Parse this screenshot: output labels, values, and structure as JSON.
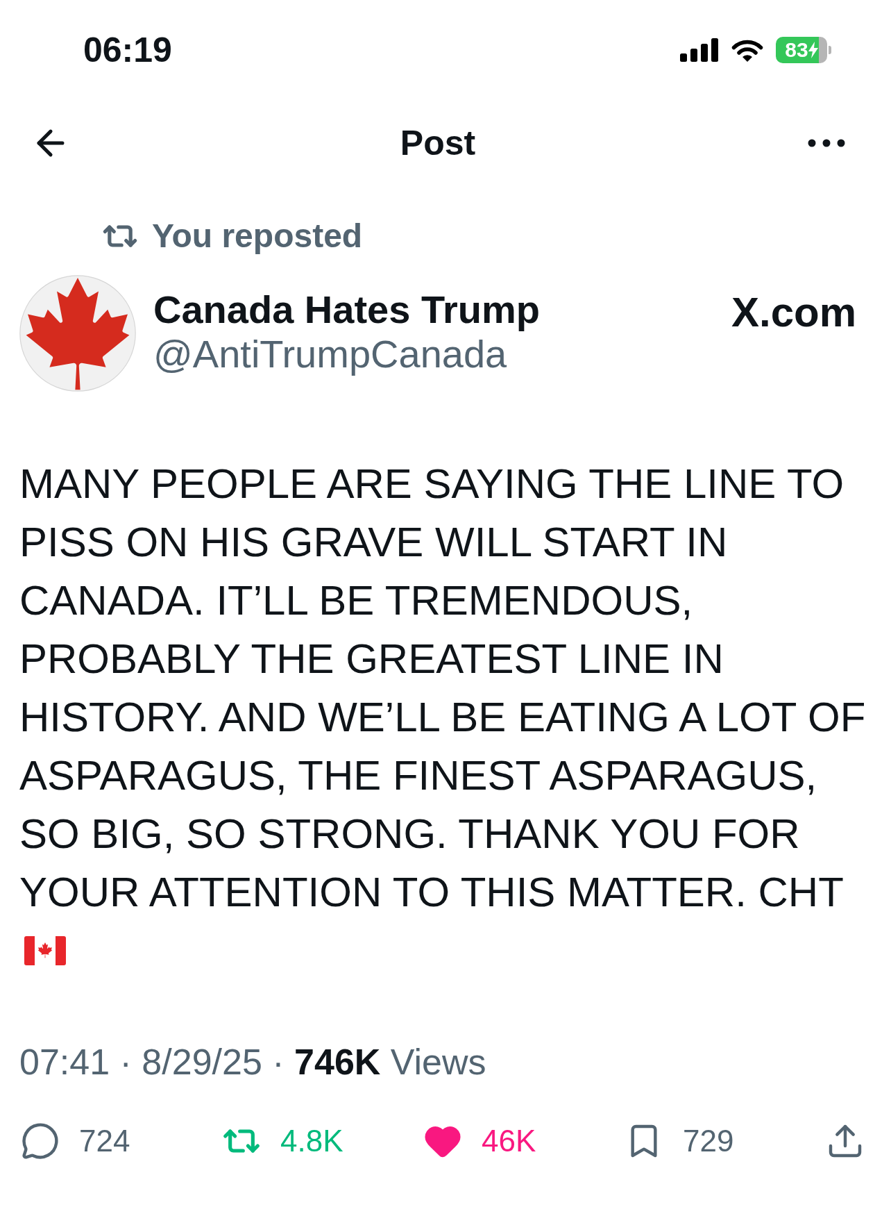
{
  "status_bar": {
    "time": "06:19",
    "battery": "83"
  },
  "header": {
    "title": "Post"
  },
  "repost_label": "You reposted",
  "author": {
    "name": "Canada Hates Trump",
    "handle": "@AntiTrumpCanada"
  },
  "source": "X.com",
  "post": {
    "text": "MANY PEOPLE ARE SAYING THE LINE TO PISS ON HIS GRAVE WILL START IN CANADA. IT’LL BE TREMENDOUS, PROBABLY THE GREATEST LINE IN HISTORY. AND WE’LL BE EATING A LOT OF ASPARAGUS, THE FINEST ASPARAGUS, SO BIG, SO STRONG. THANK YOU FOR YOUR ATTENTION TO THIS MATTER. CHT"
  },
  "meta": "07:41 · 8/29/25 · **746K** Views",
  "actions": [
    {
      "kind": "reply",
      "count": "724",
      "active": false
    },
    {
      "kind": "repost",
      "count": "4.8K",
      "active": true
    },
    {
      "kind": "like",
      "count": "46K",
      "active": true
    },
    {
      "kind": "bookmark",
      "count": "729",
      "active": false
    },
    {
      "kind": "share",
      "active": false
    }
  ]
}
